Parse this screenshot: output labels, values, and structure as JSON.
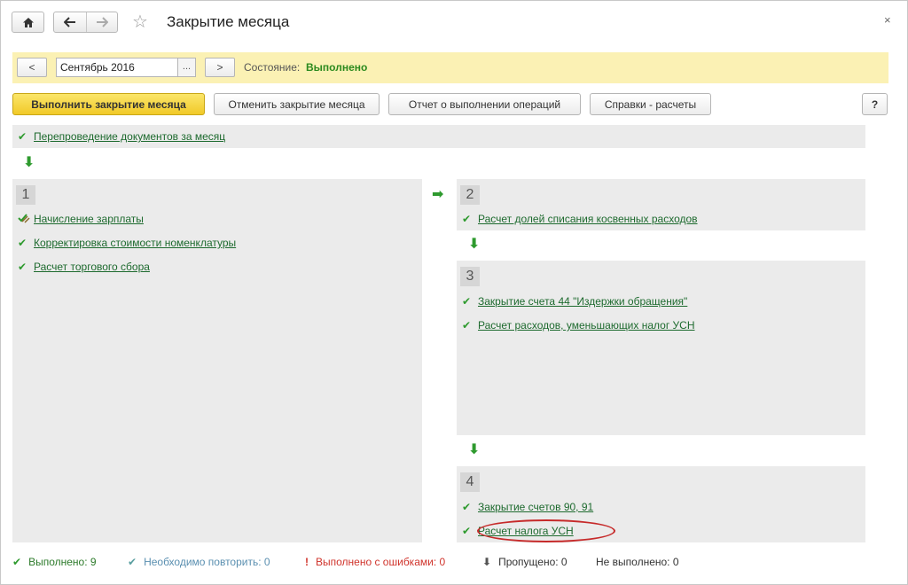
{
  "window": {
    "title": "Закрытие месяца",
    "close_icon": "×"
  },
  "toolbar": {
    "home_icon": "home-icon",
    "back_icon": "arrow-left-icon",
    "forward_icon": "arrow-right-icon",
    "favorite_icon": "star-icon"
  },
  "period": {
    "prev_label": "<",
    "value": "Сентябрь 2016",
    "select_label": "...",
    "next_label": ">",
    "state_label": "Состояние:",
    "state_value": "Выполнено"
  },
  "actions": {
    "close_month": "Выполнить закрытие месяца",
    "cancel_close": "Отменить закрытие месяца",
    "report": "Отчет о выполнении операций",
    "calculations": "Справки - расчеты",
    "help": "?"
  },
  "pre_step": {
    "label": "Перепроведение документов за месяц"
  },
  "steps": [
    {
      "number": "1",
      "operations": [
        {
          "label": "Начисление зарплаты",
          "status": "partial"
        },
        {
          "label": "Корректировка стоимости номенклатуры",
          "status": "done"
        },
        {
          "label": "Расчет торгового сбора",
          "status": "done"
        }
      ]
    },
    {
      "number": "2",
      "operations": [
        {
          "label": "Расчет долей списания косвенных расходов",
          "status": "done"
        }
      ]
    },
    {
      "number": "3",
      "operations": [
        {
          "label": "Закрытие счета 44 \"Издержки обращения\"",
          "status": "done"
        },
        {
          "label": "Расчет расходов, уменьшающих налог УСН",
          "status": "done"
        }
      ]
    },
    {
      "number": "4",
      "operations": [
        {
          "label": "Закрытие счетов 90, 91",
          "status": "done"
        },
        {
          "label": "Расчет налога УСН",
          "status": "done"
        }
      ]
    }
  ],
  "status": {
    "done": "Выполнено: 9",
    "repeat": "Необходимо повторить: 0",
    "errors": "Выполнено с ошибками: 0",
    "skipped": "Пропущено: 0",
    "not_done": "Не выполнено: 0"
  },
  "colors": {
    "accent_yellow": "#f1c928",
    "period_bar": "#fbf1b4",
    "done_green": "#2e9a2e",
    "link_green": "#1d6a2e",
    "error_red": "#d0342c",
    "repeat_blue": "#5a8fb0",
    "highlight_red": "#c62a2a"
  }
}
